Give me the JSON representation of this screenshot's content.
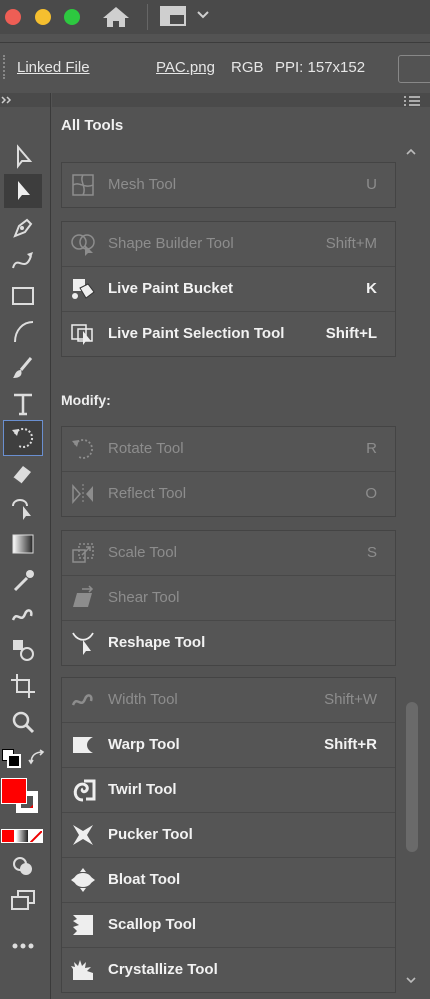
{
  "window": {
    "traffic_lights": {
      "close": "#ee5e55",
      "minimize": "#f5bf2f",
      "zoom": "#2dc840"
    }
  },
  "propbar": {
    "linked_file": "Linked File",
    "filename": "PAC.png",
    "color_mode": "RGB",
    "ppi": "PPI: 157x152"
  },
  "panel": {
    "title": "All Tools",
    "modify_heading": "Modify:",
    "groups": [
      [
        {
          "name": "Mesh Tool",
          "shortcut": "U",
          "state": "dim"
        }
      ],
      [
        {
          "name": "Shape Builder Tool",
          "shortcut": "Shift+M",
          "state": "dim"
        },
        {
          "name": "Live Paint Bucket",
          "shortcut": "K",
          "state": "act"
        },
        {
          "name": "Live Paint Selection Tool",
          "shortcut": "Shift+L",
          "state": "act"
        }
      ],
      [
        {
          "name": "Rotate Tool",
          "shortcut": "R",
          "state": "dim"
        },
        {
          "name": "Reflect Tool",
          "shortcut": "O",
          "state": "dim"
        }
      ],
      [
        {
          "name": "Scale Tool",
          "shortcut": "S",
          "state": "dim"
        },
        {
          "name": "Shear Tool",
          "shortcut": "",
          "state": "dim"
        },
        {
          "name": "Reshape Tool",
          "shortcut": "",
          "state": "act"
        }
      ],
      [
        {
          "name": "Width Tool",
          "shortcut": "Shift+W",
          "state": "dim"
        },
        {
          "name": "Warp Tool",
          "shortcut": "Shift+R",
          "state": "act"
        },
        {
          "name": "Twirl Tool",
          "shortcut": "",
          "state": "act"
        },
        {
          "name": "Pucker Tool",
          "shortcut": "",
          "state": "act"
        },
        {
          "name": "Bloat Tool",
          "shortcut": "",
          "state": "act"
        },
        {
          "name": "Scallop Tool",
          "shortcut": "",
          "state": "act"
        },
        {
          "name": "Crystallize Tool",
          "shortcut": "",
          "state": "act"
        }
      ]
    ]
  },
  "colors": {
    "fill": "#ff0000",
    "stroke": "#ffffff"
  }
}
